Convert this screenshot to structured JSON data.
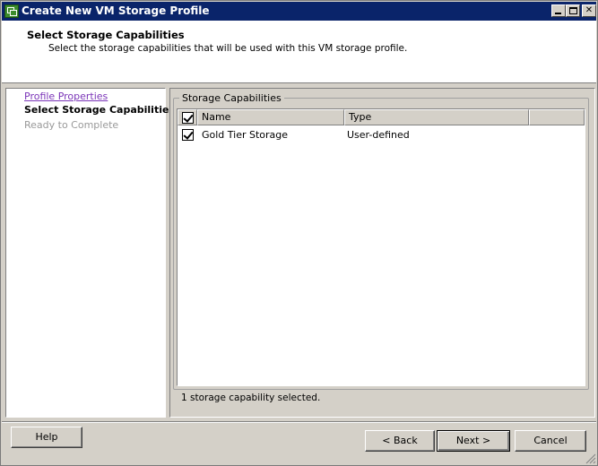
{
  "window": {
    "title": "Create New VM Storage Profile"
  },
  "header": {
    "title": "Select Storage Capabilities",
    "subtitle": "Select the storage capabilities that will be used with this VM storage profile."
  },
  "steps": [
    {
      "label": "Profile Properties",
      "state": "completed"
    },
    {
      "label": "Select Storage Capabilities",
      "state": "current"
    },
    {
      "label": "Ready to Complete",
      "state": "pending"
    }
  ],
  "group": {
    "legend": "Storage Capabilities",
    "columns": [
      "Name",
      "Type"
    ],
    "header_checked": true,
    "rows": [
      {
        "checked": true,
        "name": "Gold Tier Storage",
        "type": "User-defined"
      }
    ]
  },
  "status": "1 storage capability selected.",
  "buttons": {
    "help": "Help",
    "back": "< Back",
    "next": "Next >",
    "cancel": "Cancel"
  }
}
